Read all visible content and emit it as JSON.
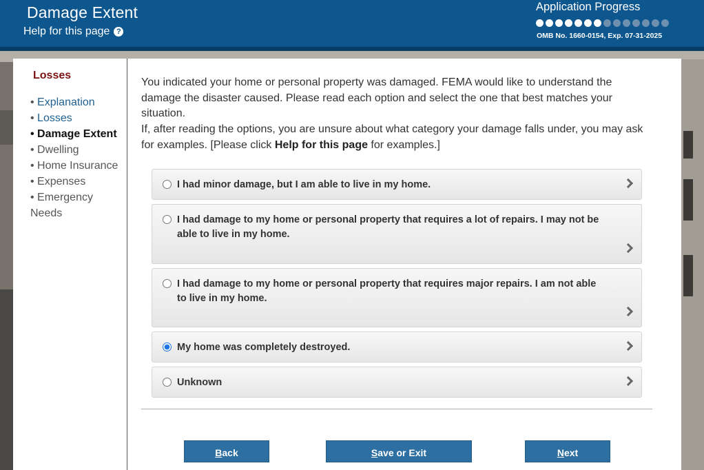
{
  "header": {
    "title": "Damage Extent",
    "help_label": "Help for this page",
    "progress_title": "Application Progress",
    "progress_steps_total": 14,
    "progress_steps_completed": 7,
    "omb_text": "OMB No. 1660-0154, Exp. 07-31-2025",
    "colors": {
      "banner": "#0d568e",
      "accent_button": "#2e6fa2"
    }
  },
  "sidebar": {
    "heading": "Losses",
    "items": [
      {
        "label": "Explanation",
        "state": "link"
      },
      {
        "label": "Losses",
        "state": "link"
      },
      {
        "label": "Damage Extent",
        "state": "current"
      },
      {
        "label": "Dwelling",
        "state": "inactive"
      },
      {
        "label": "Home Insurance",
        "state": "inactive"
      },
      {
        "label": "Expenses",
        "state": "inactive"
      },
      {
        "label": "Emergency Needs",
        "state": "inactive"
      }
    ]
  },
  "main": {
    "intro_line1": "You indicated your home or personal property was damaged. FEMA would like to understand the damage the disaster caused. Please read each option and select the one that best matches your situation.",
    "intro_line2_before": "If, after reading the options, you are unsure about what category your damage falls under, you may ask for examples. [Please click ",
    "intro_line2_bold": "Help for this page",
    "intro_line2_after": " for examples.]",
    "options": [
      {
        "label": "I had minor damage, but I am able to live in my home.",
        "selected": false
      },
      {
        "label": "I had damage to my home or personal property that requires a lot of repairs. I may not be able to live in my home.",
        "selected": false
      },
      {
        "label": "I had damage to my home or personal property that requires major repairs. I am not able to live in my home.",
        "selected": false
      },
      {
        "label": "My home was completely destroyed.",
        "selected": true
      },
      {
        "label": "Unknown",
        "selected": false
      }
    ]
  },
  "buttons": {
    "back_key": "B",
    "back_rest": "ack",
    "save_key": "S",
    "save_rest": "ave or Exit",
    "next_key": "N",
    "next_rest": "ext"
  }
}
